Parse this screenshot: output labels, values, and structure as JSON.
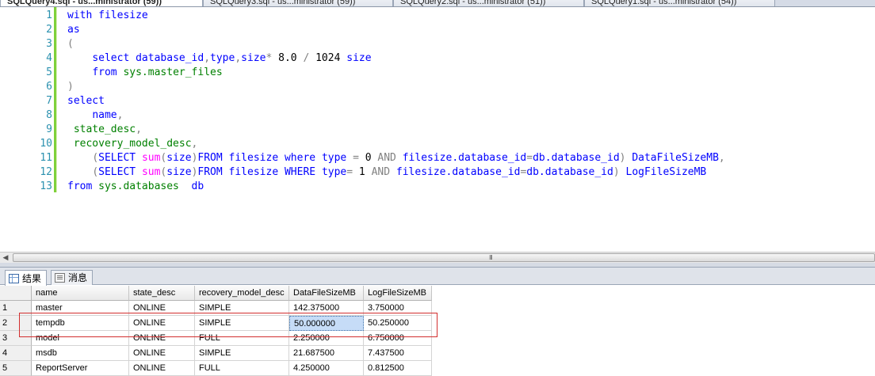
{
  "tabs": [
    {
      "label": "SQLQuery4.sql - us...ministrator (59))",
      "active": true
    },
    {
      "label": "SQLQuery3.sql - us...ministrator (59))",
      "active": false
    },
    {
      "label": "SQLQuery2.sql - us...ministrator (51))",
      "active": false
    },
    {
      "label": "SQLQuery1.sql - us...ministrator (54))",
      "active": false
    }
  ],
  "editor": {
    "line_numbers": [
      "1",
      "2",
      "3",
      "4",
      "5",
      "6",
      "7",
      "8",
      "9",
      "10",
      "11",
      "12",
      "13"
    ],
    "lines": [
      [
        {
          "c": "kw",
          "t": "with "
        },
        {
          "c": "kw",
          "t": "filesize"
        }
      ],
      [
        {
          "c": "kw",
          "t": "as"
        }
      ],
      [
        {
          "c": "gr",
          "t": "("
        }
      ],
      [
        {
          "c": "tx",
          "t": "    "
        },
        {
          "c": "kw",
          "t": "select "
        },
        {
          "c": "kw",
          "t": "database_id"
        },
        {
          "c": "gr",
          "t": ","
        },
        {
          "c": "kw",
          "t": "type"
        },
        {
          "c": "gr",
          "t": ","
        },
        {
          "c": "kw",
          "t": "size"
        },
        {
          "c": "gr",
          "t": "* "
        },
        {
          "c": "tx",
          "t": "8.0 "
        },
        {
          "c": "gr",
          "t": "/ "
        },
        {
          "c": "tx",
          "t": "1024 "
        },
        {
          "c": "kw",
          "t": "size"
        }
      ],
      [
        {
          "c": "tx",
          "t": "    "
        },
        {
          "c": "kw",
          "t": "from "
        },
        {
          "c": "sy",
          "t": "sys.master_files"
        }
      ],
      [
        {
          "c": "gr",
          "t": ")"
        }
      ],
      [
        {
          "c": "kw",
          "t": "select"
        }
      ],
      [
        {
          "c": "tx",
          "t": "    "
        },
        {
          "c": "kw",
          "t": "name"
        },
        {
          "c": "gr",
          "t": ","
        }
      ],
      [
        {
          "c": "tx",
          "t": " "
        },
        {
          "c": "sy",
          "t": "state_desc"
        },
        {
          "c": "gr",
          "t": ","
        }
      ],
      [
        {
          "c": "tx",
          "t": " "
        },
        {
          "c": "sy",
          "t": "recovery_model_desc"
        },
        {
          "c": "gr",
          "t": ","
        }
      ],
      [
        {
          "c": "tx",
          "t": "    "
        },
        {
          "c": "gr",
          "t": "("
        },
        {
          "c": "kw",
          "t": "SELECT "
        },
        {
          "c": "fn",
          "t": "sum"
        },
        {
          "c": "gr",
          "t": "("
        },
        {
          "c": "kw",
          "t": "size"
        },
        {
          "c": "gr",
          "t": ")"
        },
        {
          "c": "kw",
          "t": "FROM "
        },
        {
          "c": "kw",
          "t": "filesize "
        },
        {
          "c": "kw",
          "t": "where "
        },
        {
          "c": "kw",
          "t": "type "
        },
        {
          "c": "gr",
          "t": "= "
        },
        {
          "c": "tx",
          "t": "0 "
        },
        {
          "c": "gr",
          "t": "AND "
        },
        {
          "c": "kw",
          "t": "filesize.database_id"
        },
        {
          "c": "gr",
          "t": "="
        },
        {
          "c": "kw",
          "t": "db.database_id"
        },
        {
          "c": "gr",
          "t": ") "
        },
        {
          "c": "kw",
          "t": "DataFileSizeMB"
        },
        {
          "c": "gr",
          "t": ","
        }
      ],
      [
        {
          "c": "tx",
          "t": "    "
        },
        {
          "c": "gr",
          "t": "("
        },
        {
          "c": "kw",
          "t": "SELECT "
        },
        {
          "c": "fn",
          "t": "sum"
        },
        {
          "c": "gr",
          "t": "("
        },
        {
          "c": "kw",
          "t": "size"
        },
        {
          "c": "gr",
          "t": ")"
        },
        {
          "c": "kw",
          "t": "FROM "
        },
        {
          "c": "kw",
          "t": "filesize "
        },
        {
          "c": "kw",
          "t": "WHERE "
        },
        {
          "c": "kw",
          "t": "type"
        },
        {
          "c": "gr",
          "t": "= "
        },
        {
          "c": "tx",
          "t": "1 "
        },
        {
          "c": "gr",
          "t": "AND "
        },
        {
          "c": "kw",
          "t": "filesize.database_id"
        },
        {
          "c": "gr",
          "t": "="
        },
        {
          "c": "kw",
          "t": "db.database_id"
        },
        {
          "c": "gr",
          "t": ") "
        },
        {
          "c": "kw",
          "t": "LogFileSizeMB"
        }
      ],
      [
        {
          "c": "kw",
          "t": "from "
        },
        {
          "c": "sy",
          "t": "sys.databases"
        },
        {
          "c": "tx",
          "t": "  "
        },
        {
          "c": "kw",
          "t": "db"
        }
      ]
    ]
  },
  "scrollbar": {
    "grip": "III"
  },
  "results": {
    "tabs": [
      {
        "label": "结果",
        "icon": "grid-icon",
        "active": true
      },
      {
        "label": "消息",
        "icon": "message-icon",
        "active": false
      }
    ],
    "columns": [
      "name",
      "state_desc",
      "recovery_model_desc",
      "DataFileSizeMB",
      "LogFileSizeMB"
    ],
    "rows": [
      [
        "1",
        "master",
        "ONLINE",
        "SIMPLE",
        "142.375000",
        "3.750000"
      ],
      [
        "2",
        "tempdb",
        "ONLINE",
        "SIMPLE",
        "50.000000",
        "50.250000"
      ],
      [
        "3",
        "model",
        "ONLINE",
        "FULL",
        "2.250000",
        "6.750000"
      ],
      [
        "4",
        "msdb",
        "ONLINE",
        "SIMPLE",
        "21.687500",
        "7.437500"
      ],
      [
        "5",
        "ReportServer",
        "ONLINE",
        "FULL",
        "4.250000",
        "0.812500"
      ]
    ],
    "selected_cell": {
      "row": 1,
      "col": 4
    },
    "highlight_color": "#d32f2f"
  },
  "colors": {
    "keyword": "#0000ff",
    "function": "#ff00ff",
    "operator": "#808080",
    "system_object": "#008000",
    "line_number": "#2b91af"
  }
}
